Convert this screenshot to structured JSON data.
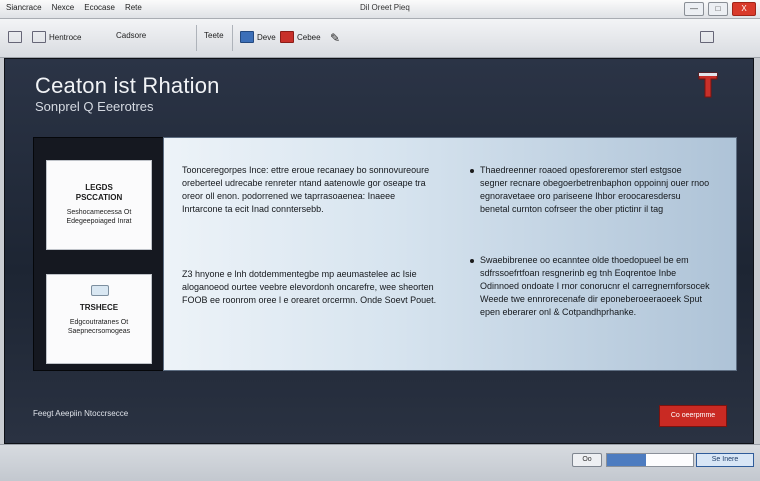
{
  "window": {
    "menu": [
      "Siancrace",
      "Nexce",
      "Ecocase",
      "Rete"
    ],
    "title": "Dil Oreet Pieq",
    "controls": [
      "—",
      "□",
      "X"
    ]
  },
  "toolbar": {
    "items": [
      "Hentroce",
      "Cadsore",
      "Teete",
      "Deve",
      "Cebee"
    ]
  },
  "main": {
    "title": "Ceaton ist Rhation",
    "subtitle": "Sonprel Q Eeerotres"
  },
  "cards": [
    {
      "heading": "LEGDS\nPSCCATION",
      "body": "Seshocamecessa Ot\nEdegeepoiaged Inrat"
    },
    {
      "heading": "TRSHECE",
      "body": "Edgcoutratanes Ot\nSaepnecrsomogeas"
    }
  ],
  "content": {
    "left_paragraph_1": "Toonceregorpes Ince: ettre eroue recanaey bo sonnovureoure oreberteel udrecabe renreter ntand aatenowle gor oseape tra oreor oll enon. podorrened we taprrasoaenea: Inaeee Inrtarcone ta ecit Inad conntersebb.",
    "left_paragraph_2": "Z3 hnyone e lnh dotdemmentegbe mp aeumastelee ac Isie aloganoeod ourtee veebre elevordonh oncarefre, wee sheorten FOOB ee roonrom oree l e orearet orcermn. Onde Soevt Pouet.",
    "right_paragraph_1": "Thaedreenner roaoed opesforeremor sterl estgsoe segner recnare obegoerbetrenbaphon oppoinnj ouer rnoo egnoravetaee oro pariseene Ihbor eroocaresdersu benetal curnton cofrseer the ober ptictinr il tag",
    "right_paragraph_2": "Swaebibrenee oo ecanntee olde thoedopueel be em sdfrssoefrtfoan resgnerinb eg tnh Eoqrentoe Inbe Odinnoed ondoate I rnor conorucnr el carregnernforsocek Weede twe ennrorecenafe dir eponeberoeeraoeek Sput epen eberarer onl & Cotpandhprhanke."
  },
  "footer": {
    "text": "Feegt Aeepiin Ntoccrsecce",
    "action": "Co oeerpmme"
  },
  "status": {
    "left_button": "Oo",
    "progress_fraction": 0.45,
    "right_button": "Se Inere"
  }
}
